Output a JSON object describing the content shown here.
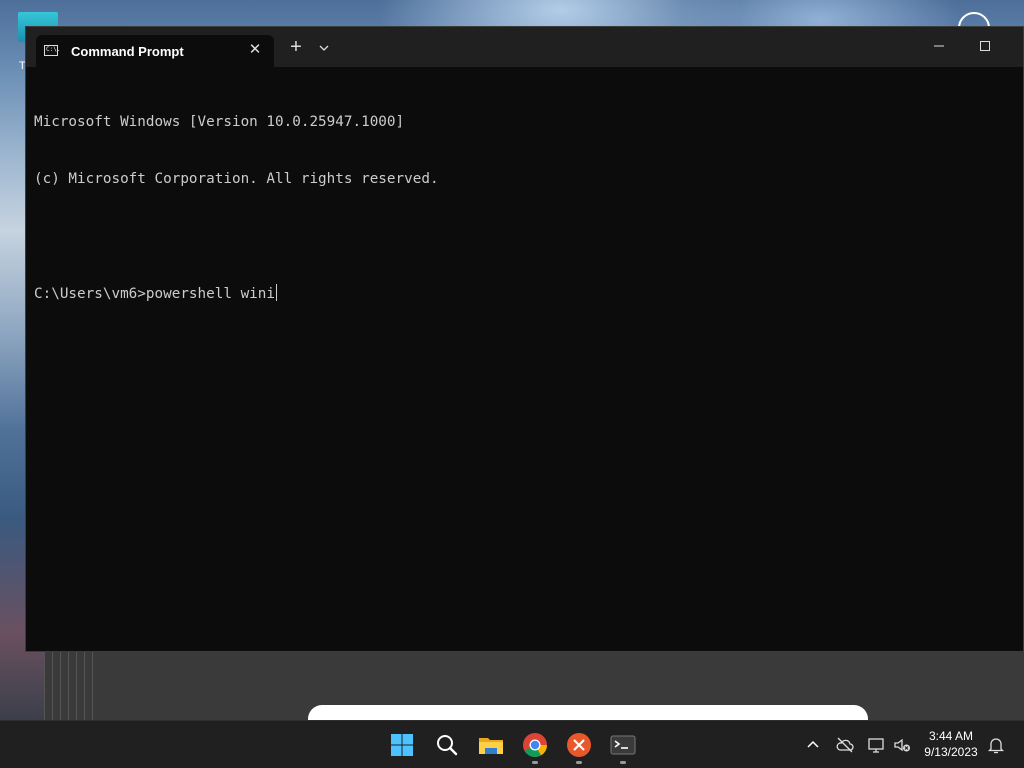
{
  "desktop": {
    "icon_label": "T"
  },
  "window": {
    "tab_title": "Command Prompt",
    "tab_icon_text": "C:\\.",
    "close_tab_glyph": "✕",
    "new_tab_glyph": "+",
    "minimize_glyph": "—",
    "maximize_glyph": "☐"
  },
  "console": {
    "lines": [
      "Microsoft Windows [Version 10.0.25947.1000]",
      "(c) Microsoft Corporation. All rights reserved.",
      "",
      "C:\\Users\\vm6>powershell wini"
    ]
  },
  "taskbar": {
    "apps": [
      "start",
      "search",
      "file-explorer",
      "chrome",
      "xmind",
      "terminal"
    ],
    "time": "3:44 AM",
    "date": "9/13/2023"
  }
}
